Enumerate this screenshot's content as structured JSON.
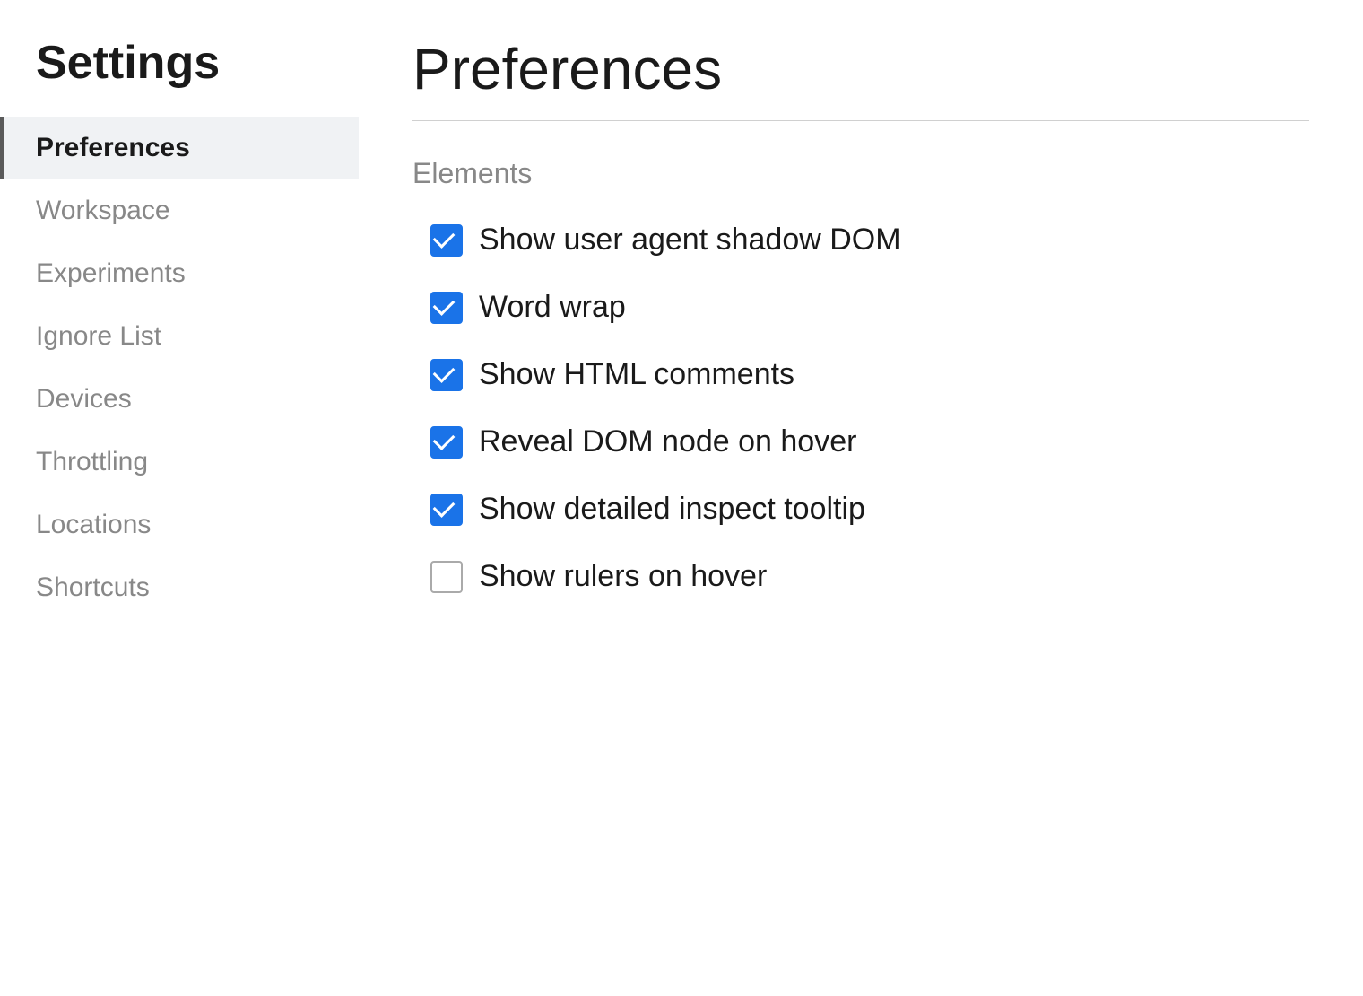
{
  "sidebar": {
    "title": "Settings",
    "nav_items": [
      {
        "id": "preferences",
        "label": "Preferences",
        "active": true
      },
      {
        "id": "workspace",
        "label": "Workspace",
        "active": false
      },
      {
        "id": "experiments",
        "label": "Experiments",
        "active": false
      },
      {
        "id": "ignore-list",
        "label": "Ignore List",
        "active": false
      },
      {
        "id": "devices",
        "label": "Devices",
        "active": false
      },
      {
        "id": "throttling",
        "label": "Throttling",
        "active": false
      },
      {
        "id": "locations",
        "label": "Locations",
        "active": false
      },
      {
        "id": "shortcuts",
        "label": "Shortcuts",
        "active": false
      }
    ]
  },
  "main": {
    "title": "Preferences",
    "sections": [
      {
        "id": "elements",
        "title": "Elements",
        "checkboxes": [
          {
            "id": "show-user-agent-shadow-dom",
            "label": "Show user agent shadow DOM",
            "checked": true
          },
          {
            "id": "word-wrap",
            "label": "Word wrap",
            "checked": true
          },
          {
            "id": "show-html-comments",
            "label": "Show HTML comments",
            "checked": true
          },
          {
            "id": "reveal-dom-node-on-hover",
            "label": "Reveal DOM node on hover",
            "checked": true
          },
          {
            "id": "show-detailed-inspect-tooltip",
            "label": "Show detailed inspect tooltip",
            "checked": true
          },
          {
            "id": "show-rulers-on-hover",
            "label": "Show rulers on hover",
            "checked": false
          }
        ]
      }
    ]
  }
}
